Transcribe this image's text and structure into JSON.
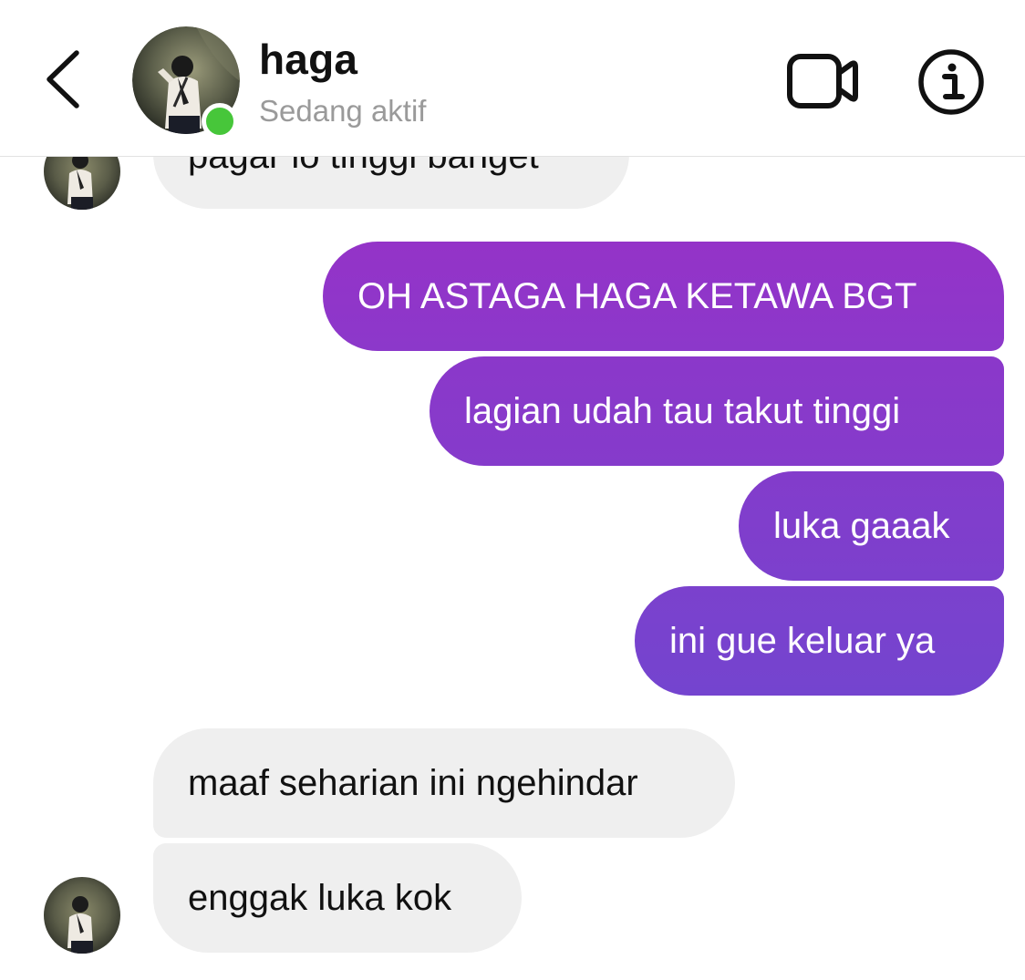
{
  "header": {
    "contact_name": "haga",
    "status": "Sedang aktif",
    "back_icon": "chevron-left-icon",
    "video_icon": "video-call-icon",
    "info_icon": "info-icon",
    "online_color": "#47c63a"
  },
  "messages": [
    {
      "from": "contact",
      "text": "pagar lo tinggi banget",
      "partially_hidden": true
    },
    {
      "from": "me",
      "text": "OH ASTAGA HAGA KETAWA BGT"
    },
    {
      "from": "me",
      "text": "lagian udah tau takut tinggi"
    },
    {
      "from": "me",
      "text": "luka gaaak"
    },
    {
      "from": "me",
      "text": "ini gue keluar ya"
    },
    {
      "from": "contact",
      "text": "maaf seharian ini ngehindar"
    },
    {
      "from": "contact",
      "text": "enggak luka kok"
    }
  ],
  "colors": {
    "incoming_bubble": "#efefef",
    "outgoing_gradient_top": "#9433c8",
    "outgoing_gradient_bottom": "#7444cf"
  }
}
